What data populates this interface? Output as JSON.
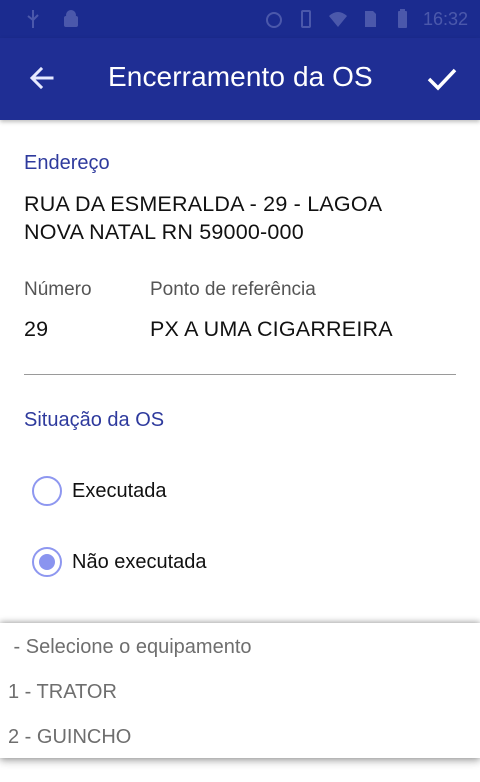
{
  "status_bar": {
    "time": "16:32",
    "icons": [
      "usb-icon",
      "android-icon",
      "alarm-icon",
      "vibrate-icon",
      "wifi-icon",
      "sim-icon",
      "battery-icon"
    ]
  },
  "app_bar": {
    "title": "Encerramento da OS",
    "back_icon": "arrow-left-icon",
    "confirm_icon": "check-icon"
  },
  "endereco": {
    "label": "Endereço",
    "value_line1": "RUA DA ESMERALDA - 29 - LAGOA",
    "value_line2": "NOVA NATAL RN 59000-000"
  },
  "numero": {
    "label": "Número",
    "value": "29"
  },
  "ponto_referencia": {
    "label": "Ponto de referência",
    "value": "PX A UMA CIGARREIRA"
  },
  "situacao": {
    "label": "Situação da OS",
    "options": [
      {
        "label": "Executada",
        "selected": false
      },
      {
        "label": "Não executada",
        "selected": true
      }
    ]
  },
  "dropdown": {
    "items": [
      {
        "label": " - Selecione o equipamento"
      },
      {
        "label": "1 - TRATOR"
      },
      {
        "label": "2 - GUINCHO"
      }
    ]
  },
  "colors": {
    "primary": "#1f2e94",
    "accent": "#8a94ef",
    "section_label": "#2e3a9d"
  }
}
